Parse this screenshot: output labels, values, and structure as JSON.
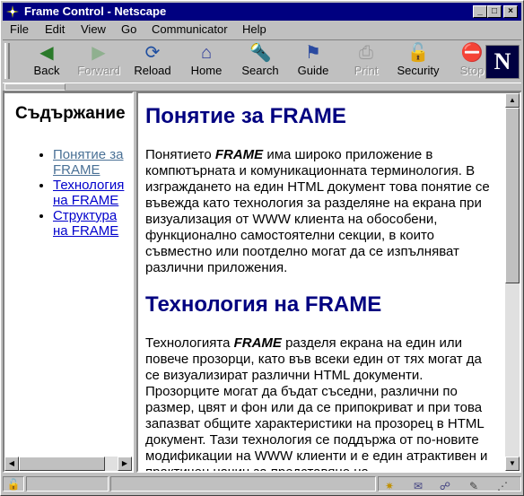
{
  "window": {
    "title": "Frame Control - Netscape"
  },
  "window_controls": {
    "minimize": "_",
    "maximize": "□",
    "close": "×"
  },
  "menu": [
    "File",
    "Edit",
    "View",
    "Go",
    "Communicator",
    "Help"
  ],
  "toolbar": {
    "buttons": [
      {
        "label": "Back",
        "icon": "back-arrow-icon",
        "enabled": true
      },
      {
        "label": "Forward",
        "icon": "forward-arrow-icon",
        "enabled": false
      },
      {
        "label": "Reload",
        "icon": "reload-icon",
        "enabled": true
      },
      {
        "label": "Home",
        "icon": "home-icon",
        "enabled": true
      },
      {
        "label": "Search",
        "icon": "search-icon",
        "enabled": true
      },
      {
        "label": "Guide",
        "icon": "guide-icon",
        "enabled": true
      },
      {
        "label": "Print",
        "icon": "print-icon",
        "enabled": false
      },
      {
        "label": "Security",
        "icon": "security-lock-icon",
        "enabled": true
      },
      {
        "label": "Stop",
        "icon": "stop-icon",
        "enabled": false
      }
    ],
    "logo": "N"
  },
  "left_frame": {
    "heading": "Съдържание",
    "links": [
      {
        "text": "Понятие за FRAME",
        "visited": true
      },
      {
        "text": "Технология на FRAME",
        "visited": false
      },
      {
        "text": "Структура на FRAME",
        "visited": false
      }
    ]
  },
  "right_frame": {
    "section1": {
      "heading": "Понятие за FRAME",
      "p_before": "Понятието ",
      "p_em": "FRAME",
      "p_after": " има широко приложение в компютърната и комуникационната терминология. В изграждането на един HTML документ това понятие се въвежда като технология за разделяне на екрана при визуализация от WWW клиента на обособени, функционално самостоятелни секции, в които съвместно или поотделно могат да се изпълняват различни приложения."
    },
    "section2": {
      "heading": "Технология на FRAME",
      "p_before": "Технологията ",
      "p_em": "FRAME",
      "p_after": " разделя екрана на един или повече прозорци, като във всеки един от тях могат да се визуализират различни HTML документи. Прозорците могат да бъдат съседни, различни по размер, цвят и фон или да се припокриват и при това запазват общите характеристики на прозорец в HTML документ. Тази технология се поддържа от по-новите модификации на WWW клиенти и е един атрактивен и практичен начин за представяне на"
    }
  },
  "colors": {
    "titlebar": "#000080",
    "heading": "#000080",
    "visited_link": "#4a7196",
    "link": "#0000cc"
  }
}
